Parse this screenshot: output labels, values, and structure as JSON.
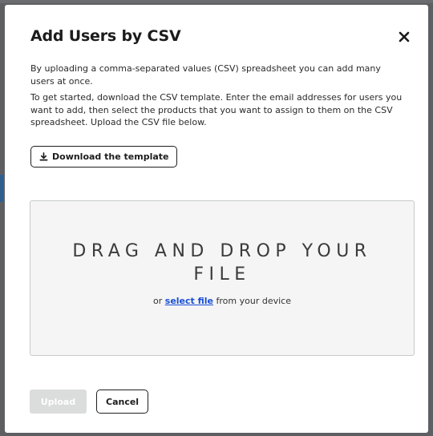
{
  "modal": {
    "title": "Add Users by CSV",
    "close_icon": "close-icon",
    "description_1": "By uploading a comma-separated values (CSV) spreadsheet you can add many users at once.",
    "description_2": "To get started, download the CSV template. Enter the email addresses for users you want to add, then select the products that you want to assign to them on the CSV spreadsheet. Upload the CSV file below.",
    "download_button": {
      "icon": "download-icon",
      "label": "Download the template"
    },
    "dropzone": {
      "title": "DRAG AND DROP YOUR FILE",
      "sub_prefix": "or",
      "link_label": "select file",
      "sub_suffix": "from your device"
    },
    "footer": {
      "upload_label": "Upload",
      "cancel_label": "Cancel"
    }
  },
  "colors": {
    "overlay": "#5d5f63",
    "link": "#1a4fd6",
    "dropzone_bg": "#f4f5f4",
    "upload_disabled_bg": "#dbdcdc"
  }
}
